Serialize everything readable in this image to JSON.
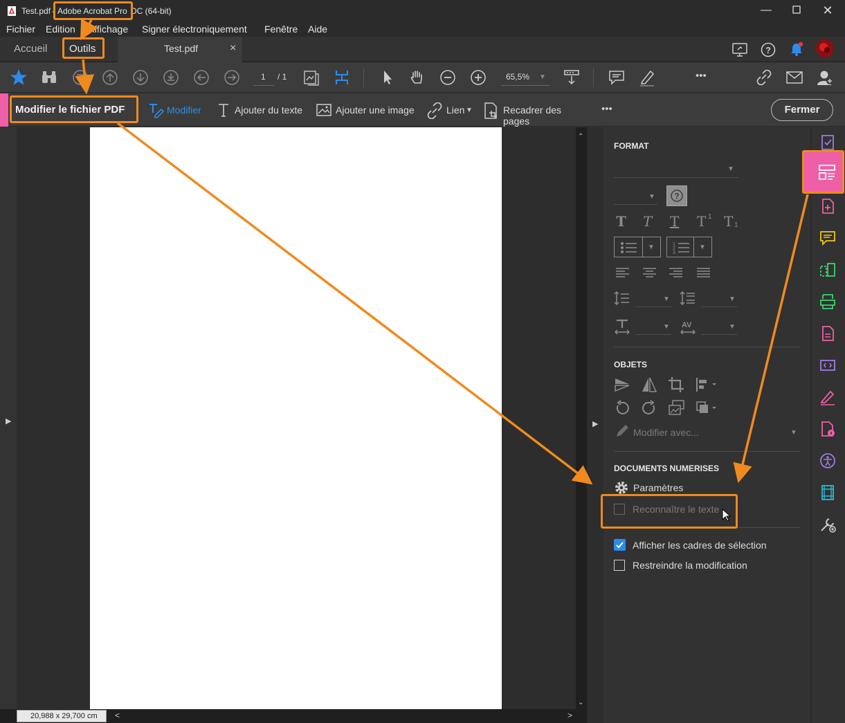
{
  "window": {
    "file_name": "Test.pdf",
    "separator": "-",
    "app_name": "Adobe Acrobat Pro",
    "app_suffix": "DC (64-bit)"
  },
  "menu": [
    "Fichier",
    "Edition",
    "Affichage",
    "Signer électroniquement",
    "Fenêtre",
    "Aide"
  ],
  "tabs": {
    "home": "Accueil",
    "tools": "Outils",
    "document": "Test.pdf",
    "close_glyph": "×"
  },
  "toolbar": {
    "page_current": "1",
    "page_total": "/ 1",
    "zoom": "65,5%",
    "more": "•••"
  },
  "editbar": {
    "title": "Modifier le fichier PDF",
    "edit": "Modifier",
    "add_text": "Ajouter du texte",
    "add_image": "Ajouter une image",
    "link": "Lien",
    "crop": "Recadrer des pages",
    "more": "•••",
    "close": "Fermer"
  },
  "panel": {
    "format_title": "FORMAT",
    "help_glyph": "?",
    "text_styles": [
      "T",
      "T",
      "T",
      "T",
      "T"
    ],
    "objects_title": "OBJETS",
    "edit_with": "Modifier avec...",
    "scanned_title": "DOCUMENTS NUMERISES",
    "settings": "Paramètres",
    "recognize_text": "Reconnaître le texte",
    "show_bounding_boxes": "Afficher les cadres de sélection",
    "restrict_editing": "Restreindre la modification",
    "show_bounding_boxes_checked": true,
    "restrict_editing_checked": false,
    "recognize_text_checked": false
  },
  "status": {
    "page_size": "20,988 x 29,700 cm"
  },
  "colors": {
    "accent_blue": "#2d8ceb",
    "pink": "#ee5fa8",
    "annotation_orange": "#f08a1e"
  },
  "icons": {
    "rail": [
      "fill-sign-icon",
      "edit-pdf-icon",
      "create-pdf-icon",
      "comment-icon",
      "organize-pages-icon",
      "scan-ocr-icon",
      "export-pdf-icon",
      "prepare-form-icon",
      "fill-sign-pen-icon",
      "protect-icon",
      "accessibility-icon",
      "rich-media-icon",
      "more-tools-icon"
    ]
  }
}
